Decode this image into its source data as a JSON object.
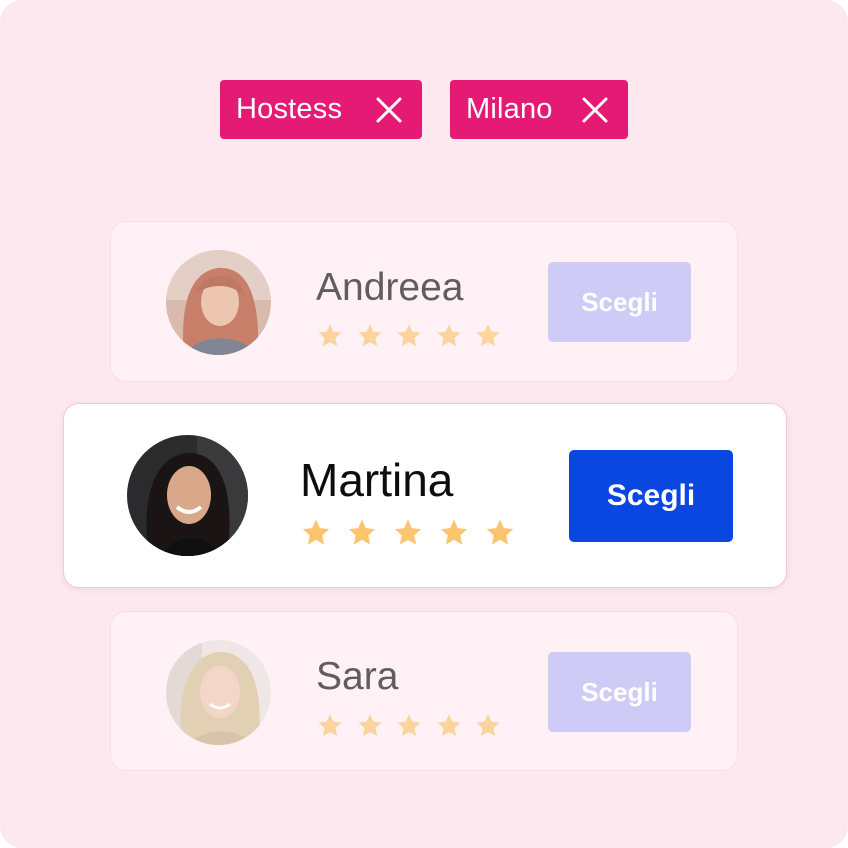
{
  "filters": [
    {
      "label": "Hostess",
      "remove_icon": "close-icon"
    },
    {
      "label": "Milano",
      "remove_icon": "close-icon"
    }
  ],
  "candidates": [
    {
      "name": "Andreea",
      "rating": 5,
      "max_rating": 5,
      "button_label": "Scegli",
      "state": "inactive"
    },
    {
      "name": "Martina",
      "rating": 5,
      "max_rating": 5,
      "button_label": "Scegli",
      "state": "selected"
    },
    {
      "name": "Sara",
      "rating": 5,
      "max_rating": 5,
      "button_label": "Scegli",
      "state": "inactive"
    }
  ],
  "colors": {
    "background": "#fde8ef",
    "chip": "#e51a74",
    "primary_button": "#0a46e0",
    "disabled_button": "#cecbf6",
    "star": "#fbc46e"
  }
}
